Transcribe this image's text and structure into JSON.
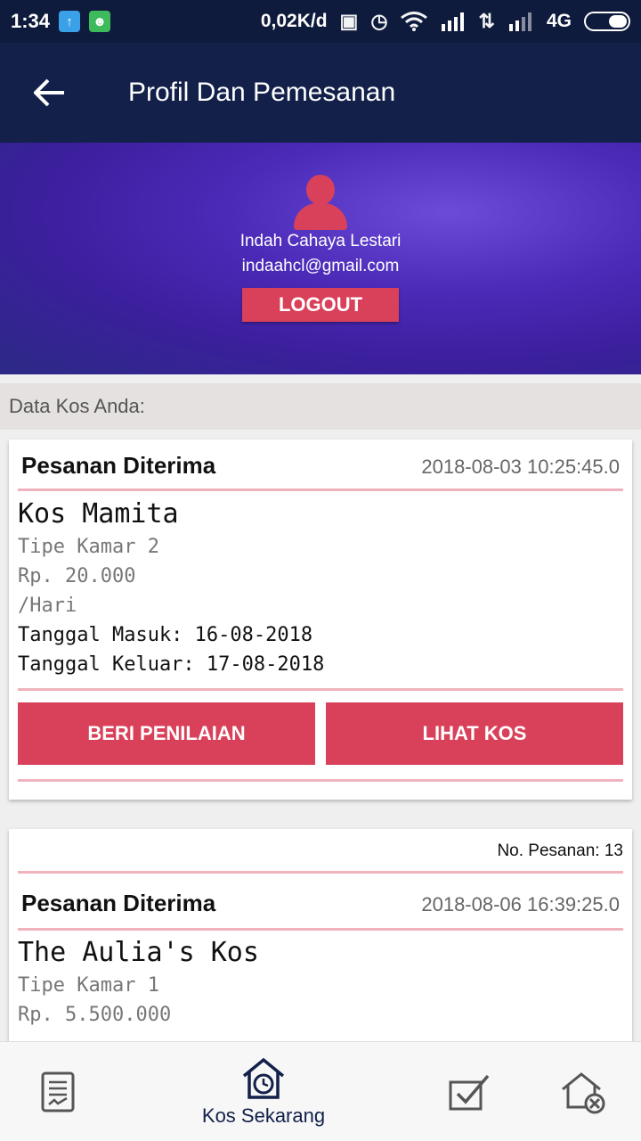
{
  "status_bar": {
    "time": "1:34",
    "network_speed": "0,02K/d",
    "network_type": "4G",
    "icons": [
      "upload-notification-icon",
      "android-notification-icon",
      "vibrate-off-icon",
      "alarm-icon",
      "wifi-icon",
      "signal-icon",
      "signal-icon",
      "battery-icon"
    ]
  },
  "appbar": {
    "back_icon": "arrow-back-icon",
    "title": "Profil Dan Pemesanan"
  },
  "profile": {
    "avatar_icon": "person-icon",
    "name": "Indah Cahaya Lestari",
    "email": "indaahcl@gmail.com",
    "logout_label": "LOGOUT"
  },
  "section_label": "Data Kos Anda:",
  "orders": [
    {
      "status": "Pesanan Diterima",
      "datetime": "2018-08-03 10:25:45.0",
      "kos_name": "Kos Mamita",
      "room_type": "Tipe Kamar 2",
      "price": "Rp. 20.000",
      "period": "/Hari",
      "check_in": "Tanggal Masuk: 16-08-2018",
      "check_out": "Tanggal Keluar: 17-08-2018",
      "rate_label": "BERI PENILAIAN",
      "view_label": "LIHAT KOS"
    },
    {
      "order_no": "No. Pesanan: 13",
      "status": "Pesanan Diterima",
      "datetime": "2018-08-06 16:39:25.0",
      "kos_name": "The Aulia's Kos",
      "room_type": "Tipe Kamar 1",
      "price": "Rp. 5.500.000"
    }
  ],
  "bottom_nav": {
    "items": [
      {
        "icon": "document-icon",
        "label": ""
      },
      {
        "icon": "house-clock-icon",
        "label": "Kos Sekarang"
      },
      {
        "icon": "checkbox-icon",
        "label": ""
      },
      {
        "icon": "house-cancel-icon",
        "label": ""
      }
    ]
  },
  "colors": {
    "appbar": "#12204a",
    "accent": "#d9415a",
    "divider": "#f0b3bd"
  }
}
